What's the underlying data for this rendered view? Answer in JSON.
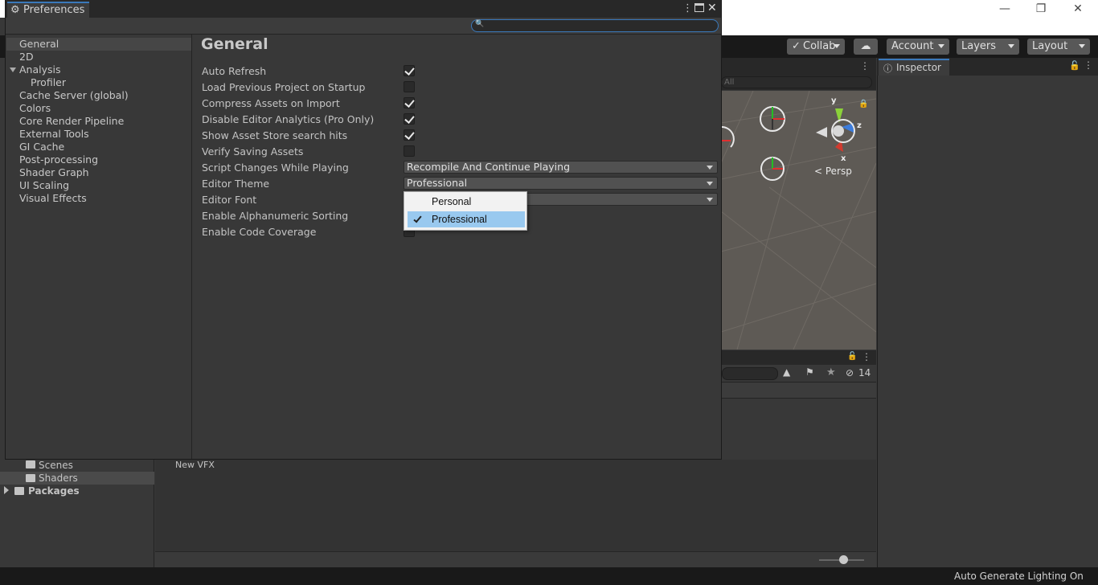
{
  "editor": {
    "toolbar": {
      "collab": "Collab",
      "account": "Account",
      "layers": "Layers",
      "layout": "Layout"
    },
    "scene": {
      "search_placeholder": "All",
      "persp_label": "< Persp",
      "axis_y": "y",
      "axis_x": "x",
      "axis_z": "z"
    },
    "inspector": {
      "tab_label": "Inspector"
    },
    "project": {
      "hidden_count": "14",
      "tree": [
        {
          "label": "Scenes"
        },
        {
          "label": "Shaders"
        },
        {
          "label": "Packages"
        }
      ],
      "asset": "New VFX"
    },
    "status": "Auto Generate Lighting On"
  },
  "preferences": {
    "window_title": "Preferences",
    "search_value": "",
    "nav": [
      {
        "label": "General"
      },
      {
        "label": "2D"
      },
      {
        "label": "Analysis"
      },
      {
        "label": "Profiler"
      },
      {
        "label": "Cache Server (global)"
      },
      {
        "label": "Colors"
      },
      {
        "label": "Core Render Pipeline"
      },
      {
        "label": "External Tools"
      },
      {
        "label": "GI Cache"
      },
      {
        "label": "Post-processing"
      },
      {
        "label": "Shader Graph"
      },
      {
        "label": "UI Scaling"
      },
      {
        "label": "Visual Effects"
      }
    ],
    "page_title": "General",
    "settings": [
      {
        "label": "Auto Refresh",
        "checked": true
      },
      {
        "label": "Load Previous Project on Startup",
        "checked": false
      },
      {
        "label": "Compress Assets on Import",
        "checked": true
      },
      {
        "label": "Disable Editor Analytics (Pro Only)",
        "checked": true
      },
      {
        "label": "Show Asset Store search hits",
        "checked": true
      },
      {
        "label": "Verify Saving Assets",
        "checked": false
      },
      {
        "label": "Script Changes While Playing",
        "value": "Recompile And Continue Playing"
      },
      {
        "label": "Editor Theme",
        "value": "Professional"
      },
      {
        "label": "Editor Font",
        "value": ""
      },
      {
        "label": "Enable Alphanumeric Sorting"
      },
      {
        "label": "Enable Code Coverage"
      }
    ],
    "theme_popup": {
      "options": [
        "Personal",
        "Professional"
      ],
      "selected": "Professional"
    }
  },
  "colors": {
    "accent": "#3a79bb",
    "selection": "#99c9ef"
  }
}
